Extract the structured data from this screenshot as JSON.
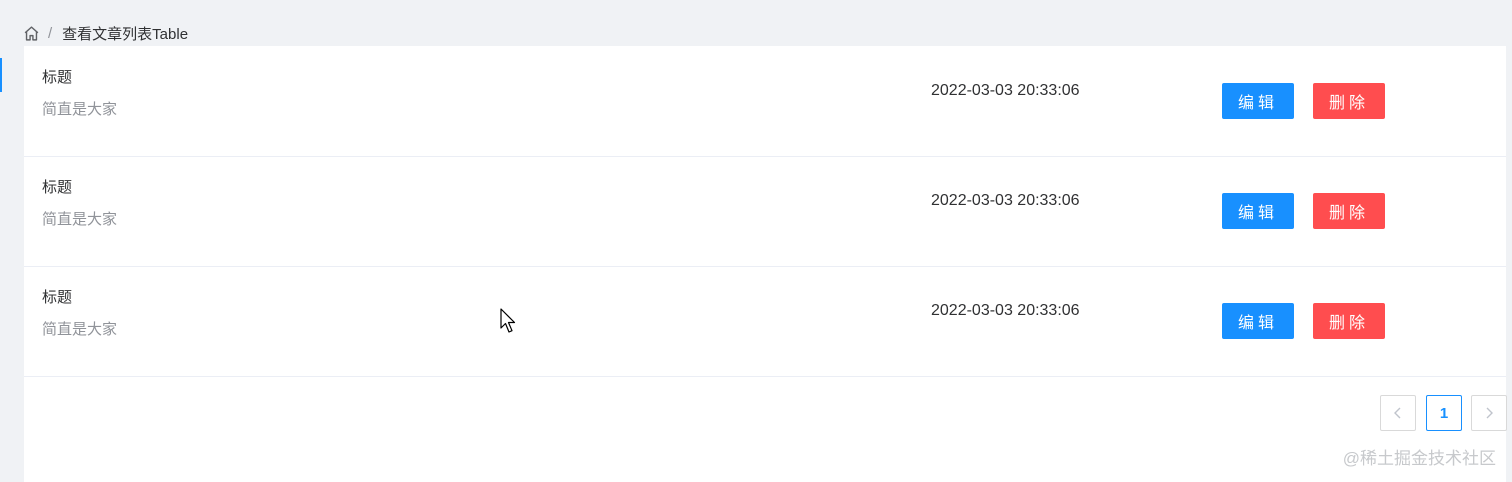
{
  "breadcrumb": {
    "separator": "/",
    "current": "查看文章列表Table"
  },
  "articles": [
    {
      "title": "标题",
      "summary": "简直是大家",
      "time": "2022-03-03 20:33:06",
      "edit_label": "编辑",
      "delete_label": "删除"
    },
    {
      "title": "标题",
      "summary": "简直是大家",
      "time": "2022-03-03 20:33:06",
      "edit_label": "编辑",
      "delete_label": "删除"
    },
    {
      "title": "标题",
      "summary": "简直是大家",
      "time": "2022-03-03 20:33:06",
      "edit_label": "编辑",
      "delete_label": "删除"
    }
  ],
  "pagination": {
    "prev_icon": "chevron-left-icon",
    "current_page": "1",
    "next_icon": "chevron-right-icon"
  },
  "watermark": "@稀土掘金技术社区",
  "colors": {
    "primary": "#1890ff",
    "danger": "#ff4d4f",
    "background": "#f0f2f5"
  }
}
